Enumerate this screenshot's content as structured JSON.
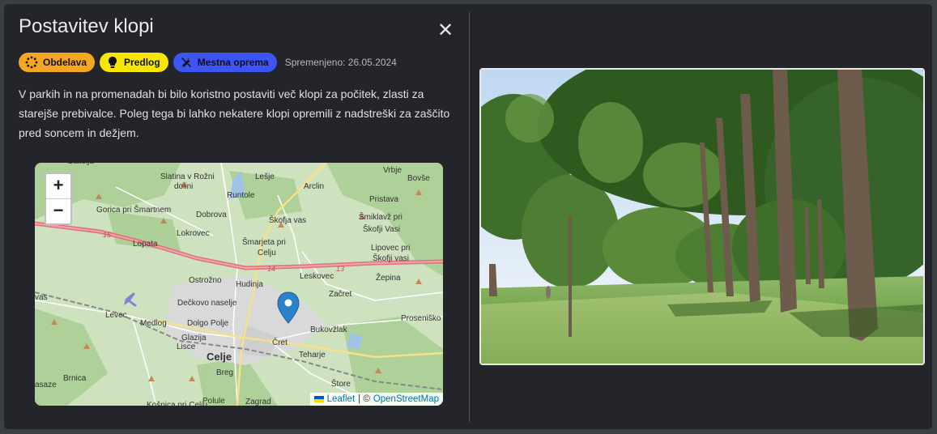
{
  "modal": {
    "title": "Postavitev klopi",
    "close_icon": "close-icon"
  },
  "badges": [
    {
      "label": "Obdelava",
      "icon": "spinner-icon",
      "color": "#f5a623"
    },
    {
      "label": "Predlog",
      "icon": "lightbulb-icon",
      "color": "#f7e600"
    },
    {
      "label": "Mestna oprema",
      "icon": "tools-icon",
      "color": "#3d55f5"
    }
  ],
  "modified": "Spremenjeno: 26.05.2024",
  "description": "V parkih in na promenadah bi bilo koristno postaviti več klopi za počitek, zlasti za starejše prebivalce. Poleg tega bi lahko nekatere klopi opremili z nadstreški za zaščito pred soncem in dežjem.",
  "map": {
    "zoom_in": "+",
    "zoom_out": "−",
    "attribution_leaflet": "Leaflet",
    "attribution_sep": "| ©",
    "attribution_osm": "OpenStreetMap",
    "places": [
      "Galicija",
      "Slatina v Rožni dolini",
      "Lešje",
      "Vrbje",
      "Bovše",
      "Runtole",
      "Arclin",
      "Pristava",
      "Gorica pri Šmartnem",
      "Dobrova",
      "Škofja vas",
      "Šmiklavž pri Škofji Vasi",
      "Lokrovec",
      "Lopata",
      "Šmarjeta pri Celju",
      "Lipovec pri Škofji vasi",
      "Ostrožno",
      "Hudinja",
      "Leskovec",
      "Žepina",
      "Dečkovo naselje",
      "Začret",
      "Levec",
      "Medlog",
      "Dolgo Polje",
      "Bukovžlak",
      "Proseniško",
      "Lisce",
      "Glazija",
      "Čret",
      "Celje",
      "Teharje",
      "Brnica",
      "Breg",
      "Štore",
      "Polule",
      "Zagrad",
      "vas",
      "asaze",
      "Košnica pri Celju"
    ],
    "road_labels": [
      "15",
      "14",
      "13"
    ]
  },
  "photo": {
    "alt": "park-trees-photo"
  }
}
